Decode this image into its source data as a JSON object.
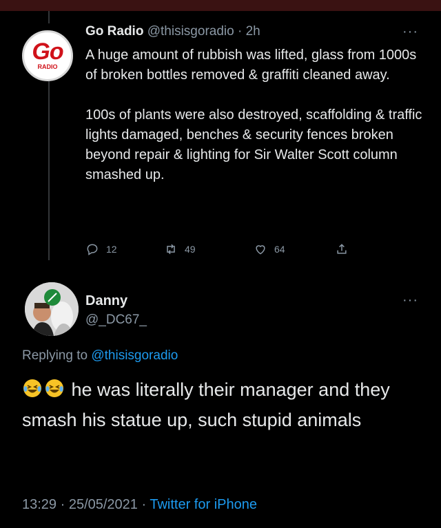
{
  "tweet": {
    "logo_text": "Go",
    "logo_sub": "RADIO",
    "display_name": "Go Radio",
    "handle": "@thisisgoradio",
    "separator": "·",
    "time_ago": "2h",
    "more_label": "···",
    "paragraph1": "A huge amount of rubbish was lifted, glass from 1000s of broken bottles removed & graffiti cleaned away.",
    "paragraph2": "100s of plants were also destroyed, scaffolding & traffic lights damaged, benches & security fences broken beyond repair & lighting for Sir Walter Scott column smashed up.",
    "replies": "12",
    "retweets": "49",
    "likes": "64",
    "icons": [
      "reply-icon",
      "retweet-icon",
      "like-icon",
      "share-icon"
    ]
  },
  "reply": {
    "display_name": "Danny",
    "handle": "@_DC67_",
    "more_label": "···",
    "replying_prefix": "Replying to",
    "replying_to": "@thisisgoradio",
    "emoji": "😂😂",
    "text": "he was literally their manager and they smash his statue up, such stupid animals",
    "timestamp": "13:29 · 25/05/2021 ·",
    "source": "Twitter for iPhone"
  },
  "colors": {
    "background": "#000000",
    "text": "#e7e9ea",
    "muted": "#8b98a5",
    "link": "#1d9bf0",
    "brand_red": "#d0121a"
  }
}
